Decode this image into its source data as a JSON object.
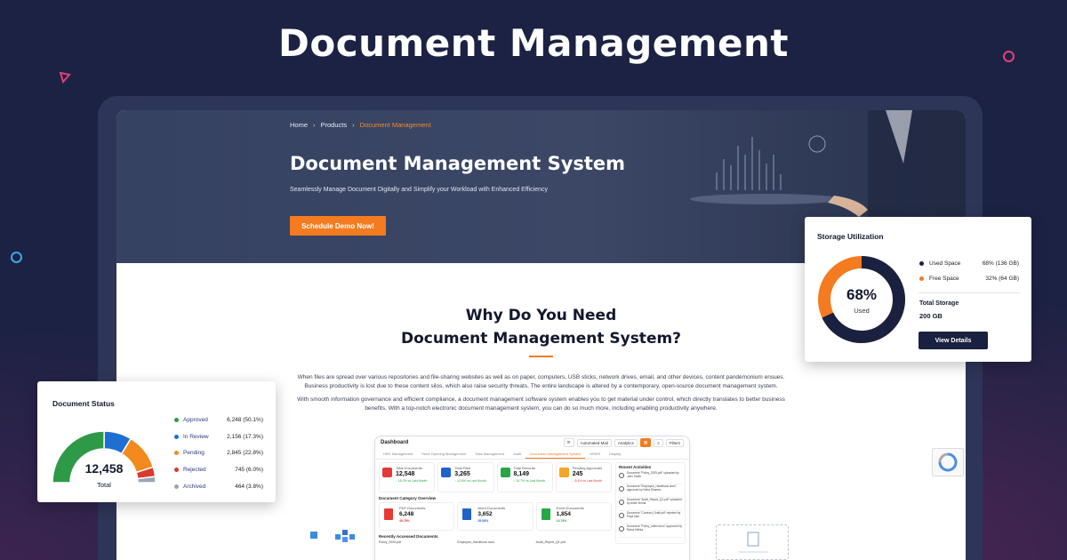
{
  "headline": "Document Management",
  "colors": {
    "background": "#1c2243",
    "accent": "#f47b20",
    "navy": "#1a2140"
  },
  "site": {
    "breadcrumb": {
      "home": "Home",
      "products": "Products",
      "current": "Document Management"
    },
    "hero": {
      "title": "Document Management System",
      "subtitle": "Seamlessly Manage Document Digitally and Simplify your Workload with Enhanced Efficiency",
      "cta": "Schedule Demo Now!"
    },
    "why": {
      "title_line1": "Why Do You Need",
      "title_line2": "Document Management System?",
      "paragraph1": "When files are spread over various repositories and file-sharing websites as well as on paper, computers, USB sticks, network drives, email, and other devices, content pandemonium ensues. Business productivity is lost due to these content silos, which also raise security threats. The entire landscape is altered by a contemporary, open-source document management system.",
      "paragraph2": "With smooth information governance and efficient compliance, a document management software system enables you to get material under control, which directly translates to better business benefits. With a top-notch electronic document management system, you can do so much more, including enabling productivity anywhere."
    }
  },
  "dashboard": {
    "title": "Dashboard",
    "toolbar": [
      "Automated Mail",
      "Analytics",
      "Filters"
    ],
    "tabs": [
      "HRC Management",
      "Store Opening Management",
      "Task Management",
      "Audit",
      "Document Management System",
      "HRMS",
      "Display"
    ],
    "active_tab": "Document Management System",
    "kpis": [
      {
        "label": "Total Documents",
        "value": "12,548",
        "delta": "↑ 18.2% vs Last Month",
        "color": "#e53935"
      },
      {
        "label": "Total Files",
        "value": "3,265",
        "delta": "↑ 12.6% vs Last Month",
        "color": "#1e63c7"
      },
      {
        "label": "Total Records",
        "value": "8,149",
        "delta": "↑ 10.7% vs Last Month",
        "color": "#27a745"
      },
      {
        "label": "Pending Approvals",
        "value": "245",
        "delta": "↓ 8.4% vs Last Month",
        "color": "#f5a623"
      }
    ],
    "category_title": "Document Category Overview",
    "categories": [
      {
        "label": "PDF Documents",
        "value": "6,248",
        "pct": "49.78%",
        "color": "#e53935"
      },
      {
        "label": "Word Documents",
        "value": "3,652",
        "pct": "29.08%",
        "color": "#1e63c7"
      },
      {
        "label": "Excel Documents",
        "value": "1,854",
        "pct": "14.76%",
        "color": "#27a745"
      }
    ],
    "recent_title": "Recently Accessed Documents",
    "recent_files": [
      "Policy_2025.pdf",
      "Employee_Handbook.docx",
      "Audit_Report_Q1.pdf"
    ],
    "activities_title": "Recent Activities",
    "activities": [
      "Document \"Policy_2025.pdf\" uploaded by John Smith",
      "Document \"Employee_Handbook.docx\" approved by Neha Sharma",
      "Document \"Audit_Report_Q1.pdf\" uploaded by Ankit Verma",
      "Document \"Contract_Draft.pdf\" rejected by Priya Nair",
      "Document \"Policy_Letter.docx\" approved by Rahul Mehta"
    ]
  },
  "storage": {
    "title": "Storage Utilization",
    "used_pct": 68,
    "center_value": "68%",
    "center_label": "Used",
    "legend": [
      {
        "label": "Used Space",
        "value": "68% (136 GB)",
        "color": "#1a2140"
      },
      {
        "label": "Free Space",
        "value": "32% (64 GB)",
        "color": "#f47b20"
      }
    ],
    "total_label": "Total Storage",
    "total_value": "200 GB",
    "button": "View Details"
  },
  "doc_status": {
    "title": "Document Status",
    "total_value": "12,458",
    "total_label": "Total",
    "items": [
      {
        "label": "Approved",
        "value": "6,248 (50.1%)",
        "share": 50.1,
        "color": "#2e9a47"
      },
      {
        "label": "In Review",
        "value": "2,156 (17.3%)",
        "share": 17.3,
        "color": "#1e6fd1"
      },
      {
        "label": "Pending",
        "value": "2,845 (22.8%)",
        "share": 22.8,
        "color": "#f28a1d"
      },
      {
        "label": "Rejected",
        "value": "745 (6.0%)",
        "share": 6.0,
        "color": "#d93a2b"
      },
      {
        "label": "Archived",
        "value": "464 (3.8%)",
        "share": 3.8,
        "color": "#9aa3b5"
      }
    ]
  }
}
